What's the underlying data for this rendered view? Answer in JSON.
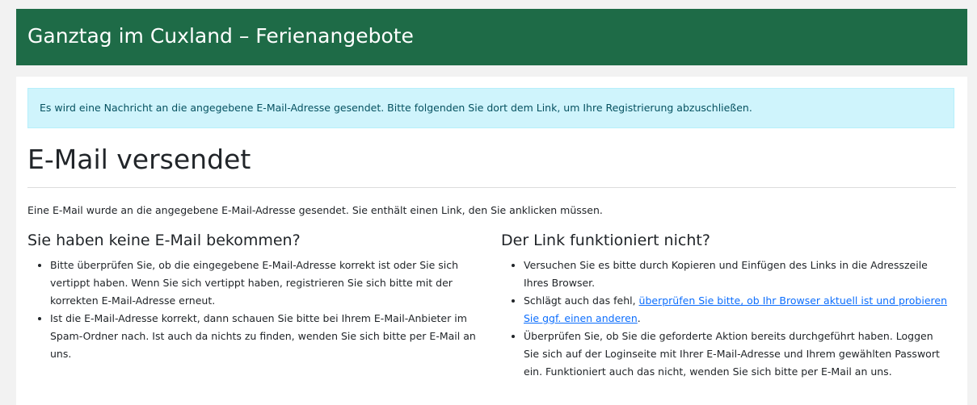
{
  "header": {
    "title": "Ganztag im Cuxland – Ferienangebote"
  },
  "alert": {
    "text": "Es wird eine Nachricht an die angegebene E-Mail-Adresse gesendet. Bitte folgenden Sie dort dem Link, um Ihre Registrierung abzuschließen."
  },
  "main": {
    "title": "E-Mail versendet",
    "lead": "Eine E-Mail wurde an die angegebene E-Mail-Adresse gesendet. Sie enthält einen Link, den Sie anklicken müssen.",
    "left": {
      "heading": "Sie haben keine E-Mail bekommen?",
      "items": [
        "Bitte überprüfen Sie, ob die eingegebene E-Mail-Adresse korrekt ist oder Sie sich vertippt haben. Wenn Sie sich vertippt haben, registrieren Sie sich bitte mit der korrekten E-Mail-Adresse erneut.",
        "Ist die E-Mail-Adresse korrekt, dann schauen Sie bitte bei Ihrem E-Mail-Anbieter im Spam-Ordner nach. Ist auch da nichts zu finden, wenden Sie sich bitte per E-Mail an uns."
      ]
    },
    "right": {
      "heading": "Der Link funktioniert nicht?",
      "item1": "Versuchen Sie es bitte durch Kopieren und Einfügen des Links in die Adresszeile Ihres Browser.",
      "item2_prefix": "Schlägt auch das fehl, ",
      "item2_link": "überprüfen Sie bitte, ob Ihr Browser aktuell ist und probieren Sie ggf. einen anderen",
      "item2_suffix": ".",
      "item3": "Überprüfen Sie, ob Sie die geforderte Aktion bereits durchgeführt haben. Loggen Sie sich auf der Loginseite mit Ihrer E-Mail-Adresse und Ihrem gewählten Passwort ein. Funktioniert auch das nicht, wenden Sie sich bitte per E-Mail an uns."
    }
  },
  "colors": {
    "header_bg": "#1e6b47",
    "alert_bg": "#cff4fc",
    "link": "#0d6efd"
  }
}
